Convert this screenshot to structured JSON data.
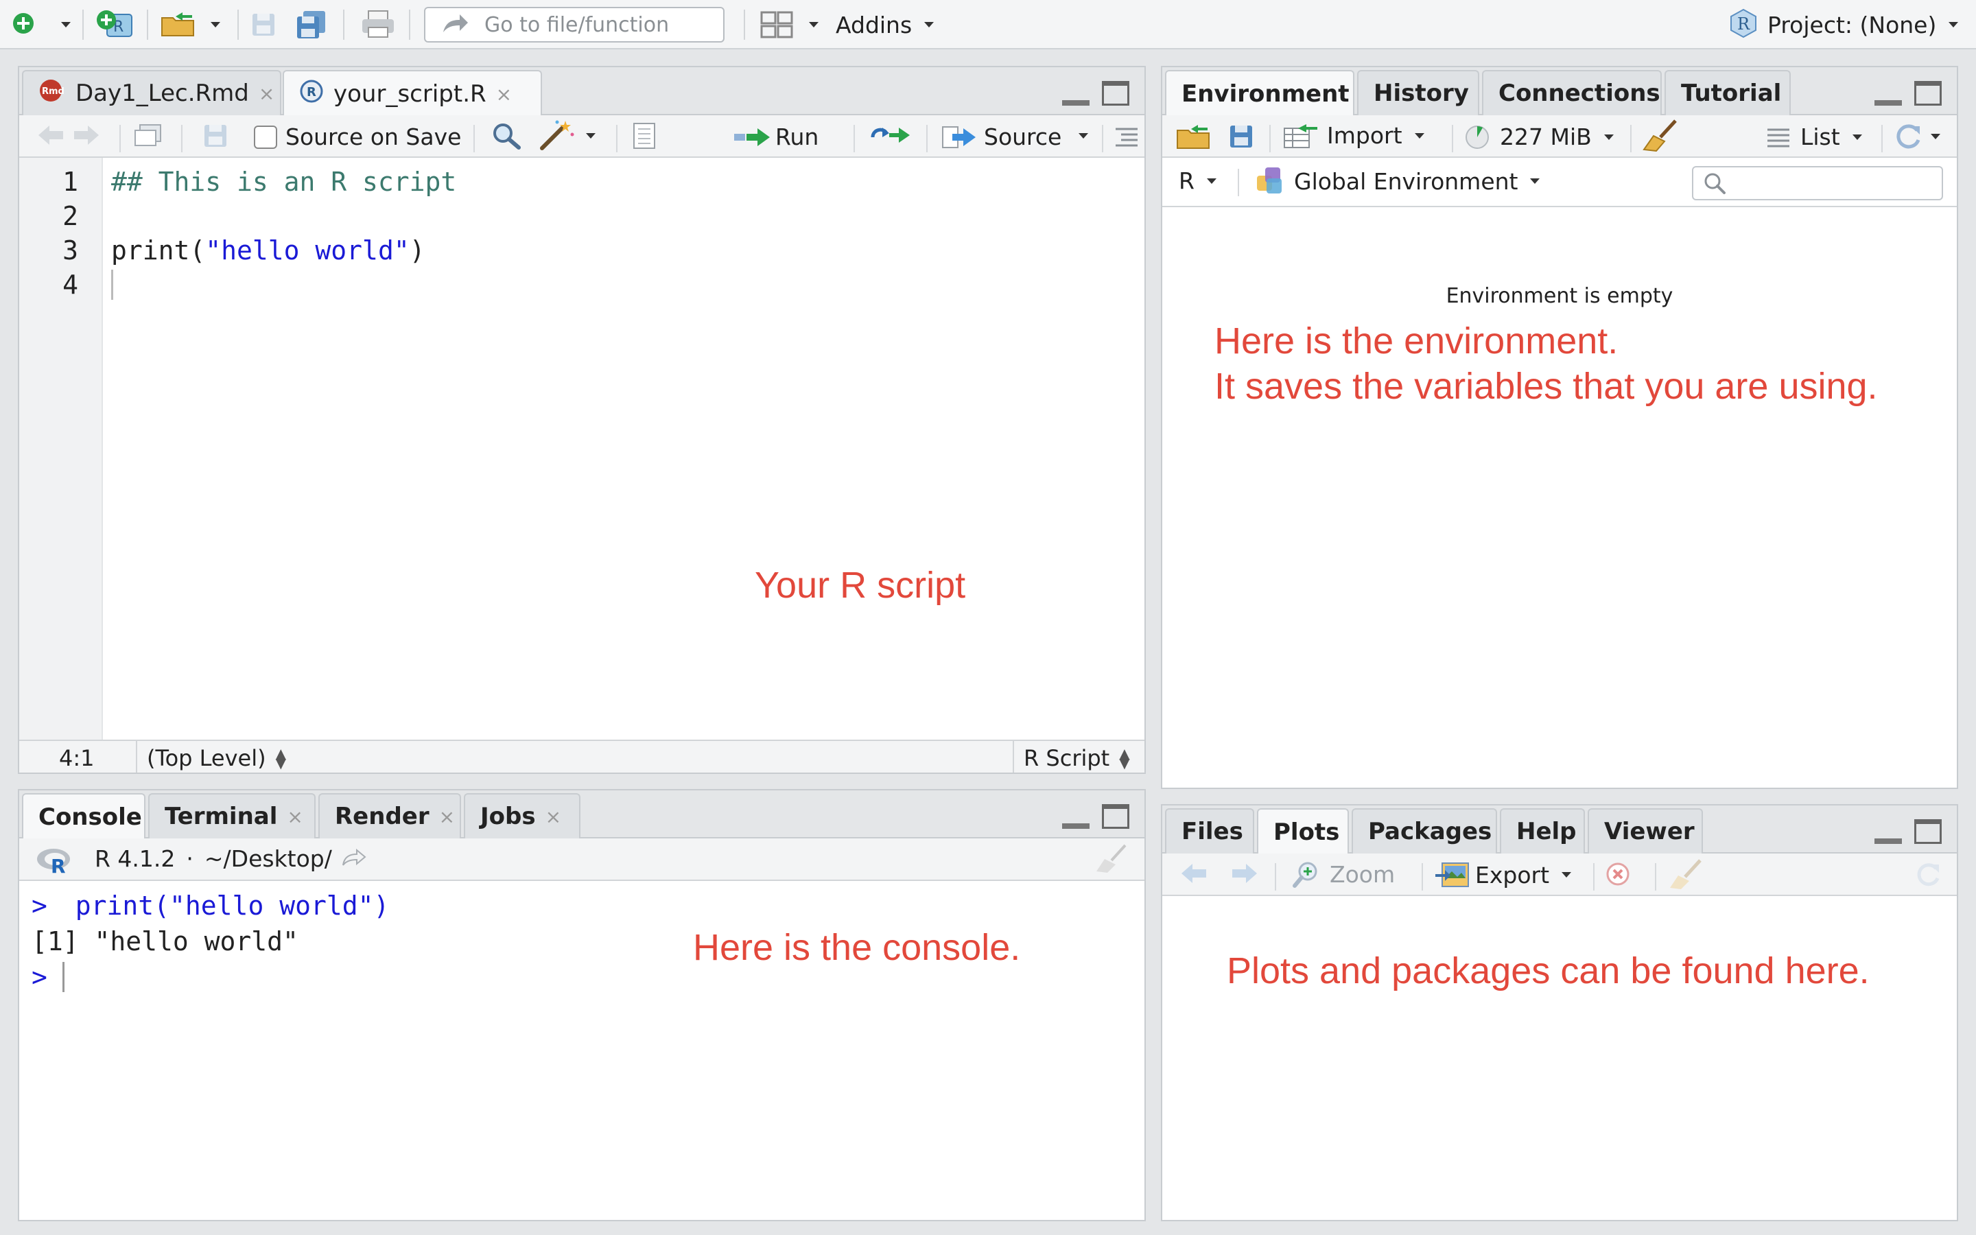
{
  "toolbar": {
    "goto_placeholder": "Go to file/function",
    "addins_label": "Addins",
    "project_label": "Project: (None)"
  },
  "editor": {
    "tabs": [
      {
        "label": "Day1_Lec.Rmd",
        "icon_text": "Rmd",
        "close": "×"
      },
      {
        "label": "your_script.R",
        "icon_text": "R",
        "close": "×"
      }
    ],
    "source_on_save": "Source on Save",
    "run_label": "Run",
    "source_label": "Source",
    "lines": [
      {
        "num": "1",
        "text": "## This is an R script"
      },
      {
        "num": "2",
        "text": ""
      },
      {
        "num": "3",
        "text_pre": "print(",
        "text_str": "\"hello world\"",
        "text_post": ")"
      },
      {
        "num": "4",
        "text": ""
      }
    ],
    "status_position": "4:1",
    "status_scope": "(Top Level)",
    "status_type": "R Script",
    "annotation": "Your R script"
  },
  "console": {
    "tabs": [
      {
        "label": "Console"
      },
      {
        "label": "Terminal",
        "close": "×"
      },
      {
        "label": "Render",
        "close": "×"
      },
      {
        "label": "Jobs",
        "close": "×"
      }
    ],
    "version": "R 4.1.2",
    "separator": "·",
    "path": "~/Desktop/",
    "lines": [
      {
        "prompt": ">",
        "text": "print(\"hello world\")"
      },
      {
        "prompt": "",
        "text": "[1] \"hello world\""
      },
      {
        "prompt": ">",
        "text": ""
      }
    ],
    "annotation": "Here is the console."
  },
  "environment": {
    "tabs": [
      {
        "label": "Environment"
      },
      {
        "label": "History"
      },
      {
        "label": "Connections"
      },
      {
        "label": "Tutorial"
      }
    ],
    "import_label": "Import",
    "memory_label": "227 MiB",
    "list_label": "List",
    "language_label": "R",
    "scope_label": "Global Environment",
    "empty_message": "Environment is empty",
    "annotation_line1": "Here is the environment.",
    "annotation_line2": "It saves the variables that you are using."
  },
  "files": {
    "tabs": [
      {
        "label": "Files"
      },
      {
        "label": "Plots"
      },
      {
        "label": "Packages"
      },
      {
        "label": "Help"
      },
      {
        "label": "Viewer"
      }
    ],
    "zoom_label": "Zoom",
    "export_label": "Export",
    "annotation": "Plots and packages can be found here."
  },
  "colors": {
    "annotation": "#e2483b",
    "comment": "#3c7a6e",
    "string": "#1a1ad6",
    "console_input": "#1a1ad6",
    "run_arrow": "#2aa34a"
  }
}
